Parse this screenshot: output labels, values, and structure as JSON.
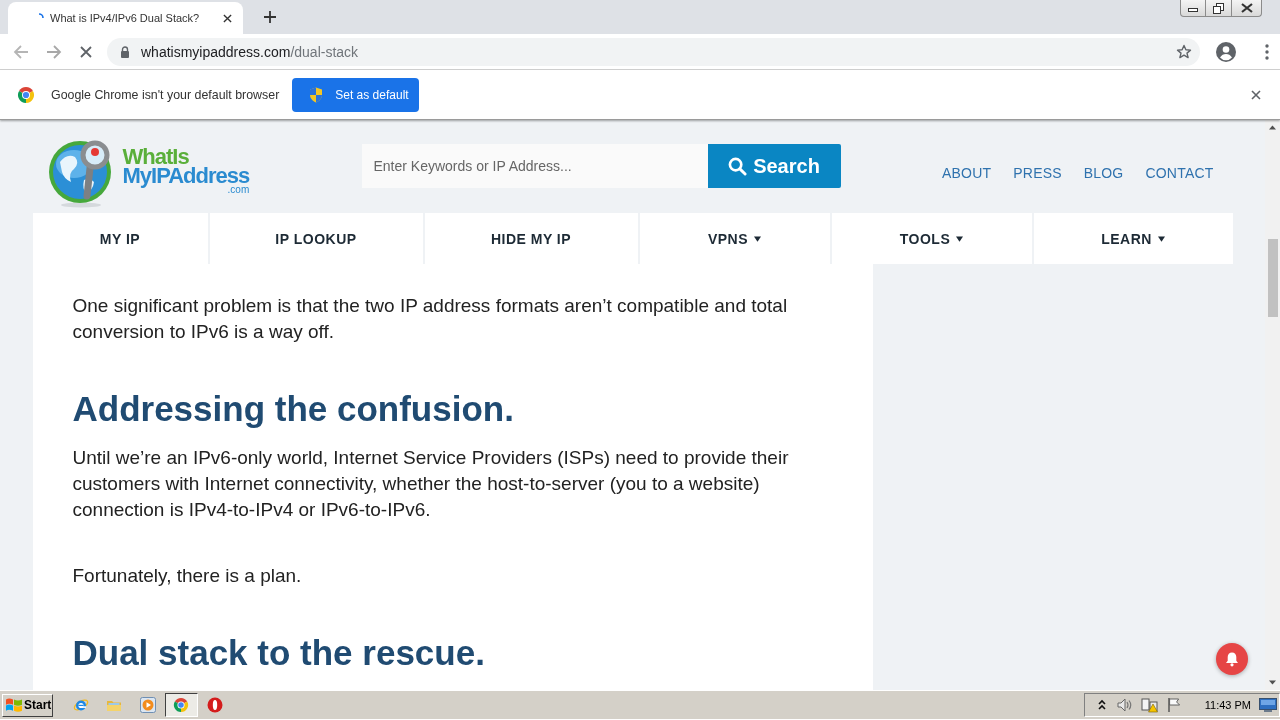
{
  "browser": {
    "tabs": [
      {
        "title": "What is IPv4/IPv6 Dual Stack?",
        "selected": true
      }
    ],
    "address": {
      "host": "whatismyipaddress.com",
      "path": "/dual-stack"
    }
  },
  "infobar": {
    "message": "Google Chrome isn't your default browser",
    "button": "Set as default"
  },
  "site": {
    "logo": {
      "line_1": "WhatIs",
      "line_2": "MyIPAddress",
      "line_3": ".com"
    },
    "search": {
      "placeholder": "Enter Keywords or IP Address...",
      "button": "Search"
    },
    "top_links": [
      "ABOUT",
      "PRESS",
      "BLOG",
      "CONTACT"
    ],
    "nav": [
      {
        "label": "MY IP",
        "dropdown": false
      },
      {
        "label": "IP LOOKUP",
        "dropdown": false
      },
      {
        "label": "HIDE MY IP",
        "dropdown": false
      },
      {
        "label": "VPNS",
        "dropdown": true
      },
      {
        "label": "TOOLS",
        "dropdown": true
      },
      {
        "label": "LEARN",
        "dropdown": true
      }
    ]
  },
  "article": [
    {
      "kind": "paragraph",
      "text": "One significant problem is that the two IP address formats aren’t compatible and total conversion to IPv6 is a way off."
    },
    {
      "kind": "heading",
      "text": "Addressing the confusion."
    },
    {
      "kind": "paragraph",
      "text": "Until we’re an IPv6-only world, Internet Service Providers (ISPs) need to provide their customers with Internet connectivity, whether the host-to-server (you to a website) connection is IPv4-to-IPv4 or IPv6-to-IPv6."
    },
    {
      "kind": "paragraph",
      "text": "Fortunately, there is a plan."
    },
    {
      "kind": "heading",
      "text": "Dual stack to the rescue."
    }
  ],
  "taskbar": {
    "start": "Start",
    "apps": [
      {
        "kind": "e-browser",
        "selected": false
      },
      {
        "kind": "folder",
        "selected": false
      },
      {
        "kind": "player",
        "selected": false
      },
      {
        "kind": "chrome",
        "selected": true
      },
      {
        "kind": "o-browser",
        "selected": false
      }
    ],
    "clock": "11:43 PM"
  }
}
